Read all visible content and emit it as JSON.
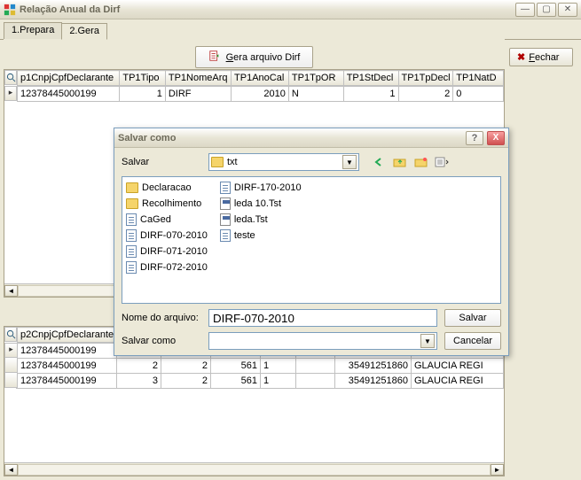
{
  "window": {
    "title": "Relação Anual da Dirf"
  },
  "tabs": {
    "t1": "1.Prepara",
    "t2": "2.Gera"
  },
  "buttons": {
    "gera": "Gera arquivo Dirf",
    "fechar": "Fechar"
  },
  "grid1": {
    "headers": [
      "p1CnpjCpfDeclarante",
      "TP1Tipo",
      "TP1NomeArq",
      "TP1AnoCal",
      "TP1TpOR",
      "TP1StDecl",
      "TP1TpDecl",
      "TP1NatD"
    ],
    "rows": [
      [
        "12378445000199",
        "1",
        "DIRF",
        "2010",
        "N",
        "1",
        "2",
        "0"
      ]
    ]
  },
  "grid2": {
    "headers": [
      "p2CnpjCpfDeclarante",
      "",
      "",
      "",
      "",
      "",
      "",
      ""
    ],
    "rows": [
      [
        "12378445000199",
        "",
        "",
        "",
        "",
        "",
        "",
        ""
      ],
      [
        "12378445000199",
        "2",
        "2",
        "561",
        "1",
        "",
        "35491251860",
        "GLAUCIA REGI"
      ],
      [
        "12378445000199",
        "3",
        "2",
        "561",
        "1",
        "",
        "35491251860",
        "GLAUCIA REGI"
      ]
    ]
  },
  "dialog": {
    "title": "Salvar como",
    "save_in_label": "Salvar",
    "folder": "txt",
    "filename_label": "Nome do arquivo:",
    "filename_value": "DIRF-070-2010",
    "type_label": "Salvar como",
    "type_value": "",
    "save_btn": "Salvar",
    "cancel_btn": "Cancelar",
    "files_col1": {
      "f0": "Declaracao",
      "f1": "Recolhimento",
      "f2": "CaGed",
      "f3": "DIRF-070-2010",
      "f4": "DIRF-071-2010",
      "f5": "DIRF-072-2010"
    },
    "files_col2": {
      "f0": "DIRF-170-2010",
      "f1": "leda 10.Tst",
      "f2": "leda.Tst",
      "f3": "teste"
    }
  }
}
